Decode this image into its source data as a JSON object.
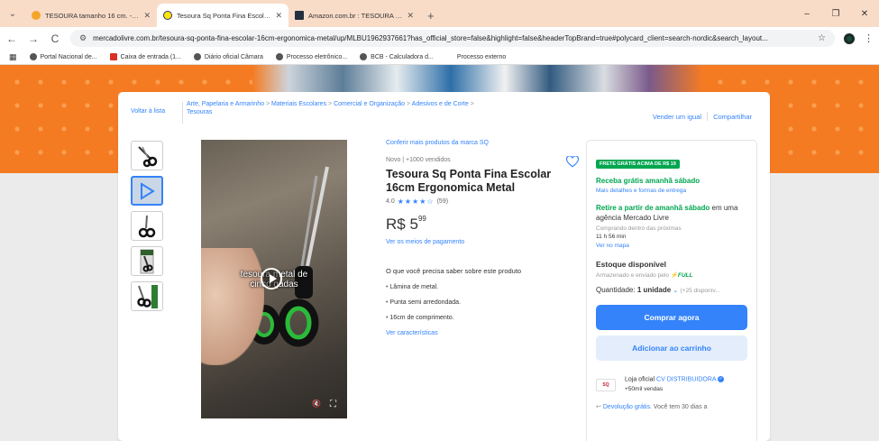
{
  "tabs": [
    {
      "title": "TESOURA tamanho 16 cm. - Go",
      "favicon_color": "#f4a62a"
    },
    {
      "title": "Tesoura Sq Ponta Fina Escolar 1",
      "favicon_color": "#ffe600"
    },
    {
      "title": "Amazon.com.br : TESOURA 16C",
      "favicon_color": "#232f3e"
    }
  ],
  "new_tab": "+",
  "window": {
    "minimize": "–",
    "restore": "❐",
    "close": "✕"
  },
  "nav": {
    "back": "←",
    "forward": "→",
    "reload": "C"
  },
  "address": {
    "url": "mercadolivre.com.br/tesoura-sq-ponta-fina-escolar-16cm-ergonomica-metal/up/MLBU1962937661?has_official_store=false&highlight=false&headerTopBrand=true#polycard_client=search-nordic&search_layout..."
  },
  "bookmarks": [
    "Portal Nacional de...",
    "Caixa de entrada (1...",
    "Diário oficial Câmara",
    "Processo eletrônico...",
    "BCB - Calculadora d...",
    "Processo externo"
  ],
  "breadcrumb": {
    "back": "Voltar à lista",
    "path": [
      "Arte, Papelaria e Armarinho",
      "Materiais Escolares",
      "Comercial e Organização",
      "Adesivos e de Corte",
      "Tesouras"
    ],
    "separator": ">"
  },
  "share": {
    "sell": "Vender um igual",
    "share": "Compartilhar"
  },
  "video": {
    "caption": "tesoura  metal de\ncinco  gadas",
    "mute": "🔇",
    "fullscreen": "⛶"
  },
  "product": {
    "brand_link": "Conferir mais produtos da marca SQ",
    "condition": "Novo  |  +1000 vendidos",
    "title": "Tesoura Sq Ponta Fina Escolar 16cm Ergonomica Metal",
    "rating": "4.0",
    "stars": "★★★★☆",
    "rating_count": "(59)",
    "price_currency": "R$",
    "price_int": "5",
    "price_cents": "99",
    "payment_link": "Ver os meios de pagamento",
    "features_title": "O que você precisa saber sobre este produto",
    "features": [
      "Lâmina de metal.",
      "Punta semi arredondada.",
      "16cm de comprimento."
    ],
    "features_link": "Ver características"
  },
  "buybox": {
    "badge": "FRETE GRÁTIS ACIMA DE R$ 19",
    "delivery": "Receba grátis amanhã sábado",
    "delivery_link": "Mais detalhes e formas de entrega",
    "pickup_green": "Retire a partir de amanhã sábado",
    "pickup_rest": " em uma agência Mercado Livre",
    "buy_within": "Comprando dentro das próximas",
    "time": "11 h 56 min",
    "map_link": "Ver no mapa",
    "stock": "Estoque disponível",
    "stored": "Armazenado e enviado pelo",
    "full": "⚡FULL",
    "qty_label": "Quantidade:",
    "qty_value": "1 unidade",
    "qty_avail": "(+25 disponív...",
    "buy_btn": "Comprar agora",
    "cart_btn": "Adicionar ao carrinho",
    "seller_prefix": "Loja oficial",
    "seller_name": "CV DISTRIBUIDORA",
    "seller_logo": "SQ",
    "seller_sales": "+50mil vendas",
    "return_prefix": "Devolução grátis.",
    "return_rest": " Você tem 30 dias a"
  }
}
